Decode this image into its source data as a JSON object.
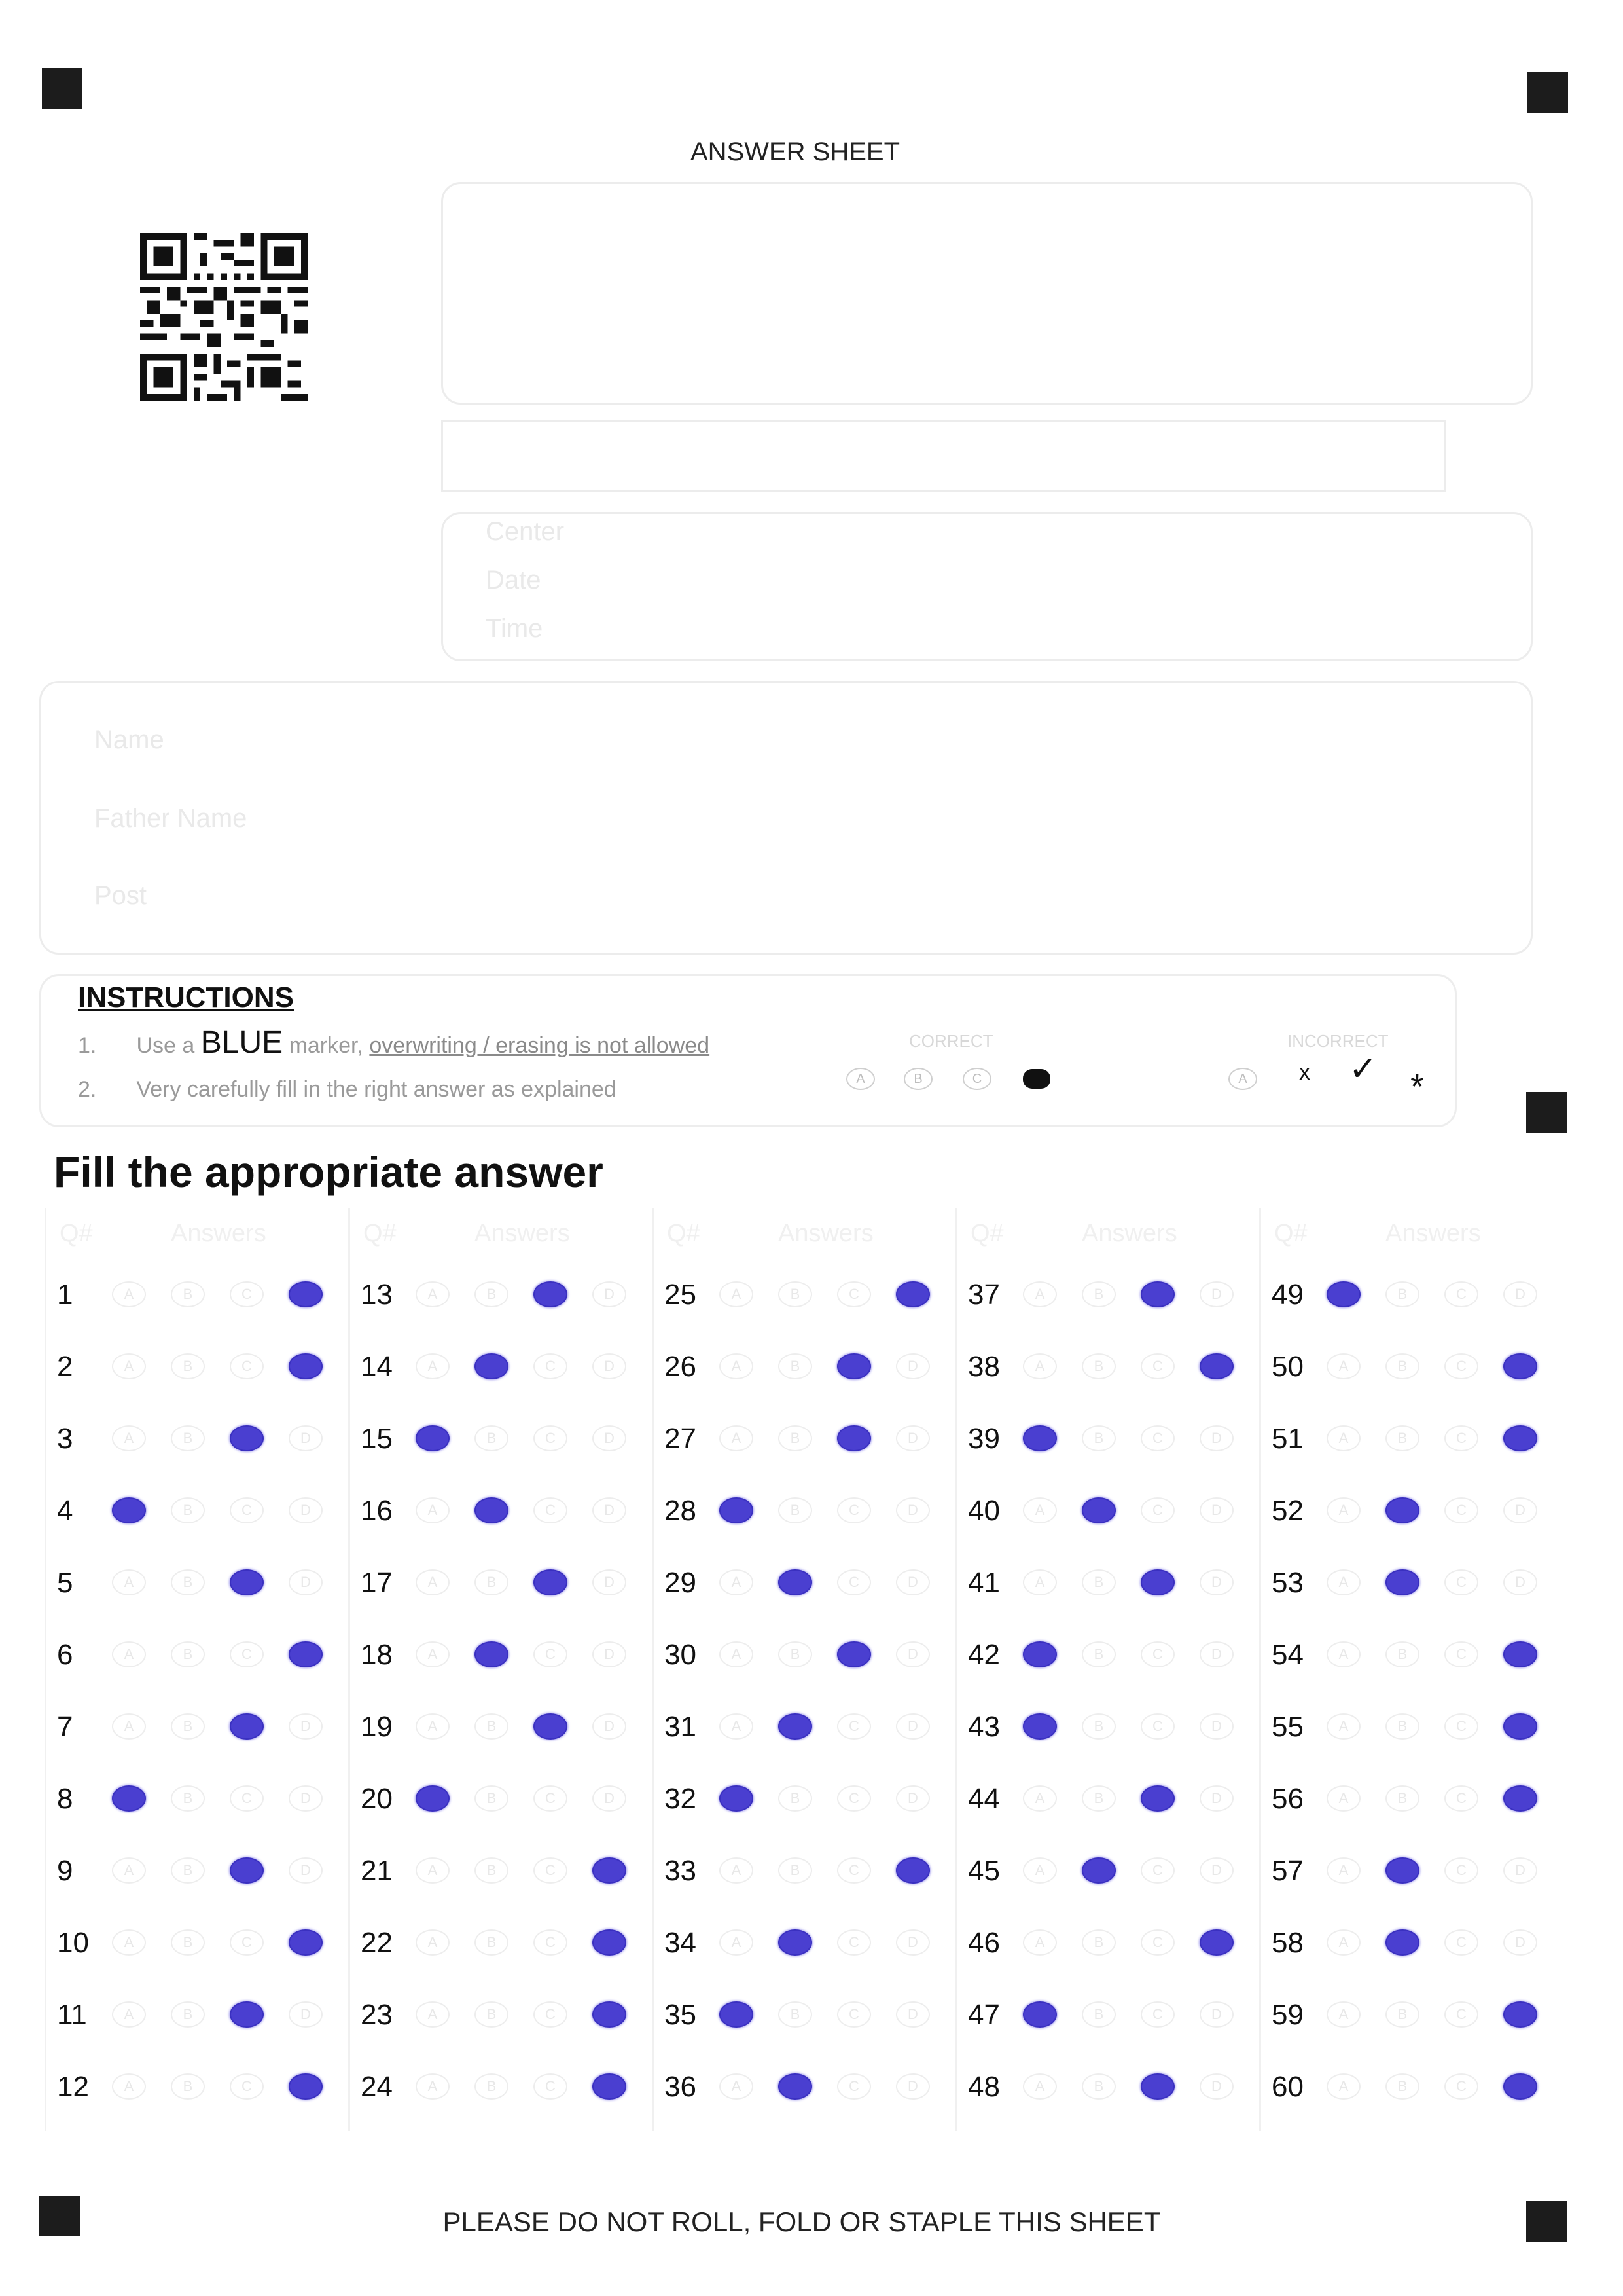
{
  "sheet": {
    "title": "ANSWER SHEET",
    "footer": "PLEASE DO NOT ROLL, FOLD OR STAPLE THIS SHEET"
  },
  "exam_info": {
    "fields": [
      "Center",
      "Date",
      "Time"
    ]
  },
  "candidate": {
    "fields": [
      "Name",
      "Father Name",
      "Post"
    ]
  },
  "instructions": {
    "heading": "INSTRUCTIONS",
    "line1_num": "1.",
    "line1_pre": "Use a",
    "line1_blue": "BLUE",
    "line1_mid": "marker,",
    "line1_under": "overwriting / erasing is not allowed",
    "line2_num": "2.",
    "line2_text": "Very carefully fill in the right answer as explained",
    "correct_label": "CORRECT",
    "incorrect_label": "INCORRECT",
    "correct_options": [
      "A",
      "B",
      "C"
    ],
    "incorrect_options": [
      "A"
    ],
    "incorrect_marks": [
      "x",
      "✓",
      "*"
    ]
  },
  "answers_section": {
    "heading": "Fill the appropriate answer",
    "col_header_q": "Q#",
    "col_header_answers": "Answers",
    "option_letters": [
      "A",
      "B",
      "C",
      "D"
    ],
    "filled_color": "#4a3fd0",
    "marked": [
      4,
      4,
      3,
      1,
      3,
      4,
      3,
      1,
      3,
      4,
      3,
      4,
      3,
      2,
      1,
      2,
      3,
      2,
      3,
      1,
      4,
      4,
      4,
      4,
      4,
      3,
      3,
      1,
      2,
      3,
      2,
      1,
      4,
      2,
      1,
      2,
      3,
      4,
      1,
      2,
      3,
      1,
      1,
      3,
      2,
      4,
      1,
      3,
      1,
      4,
      4,
      2,
      2,
      4,
      4,
      4,
      2,
      2,
      4,
      4
    ]
  }
}
